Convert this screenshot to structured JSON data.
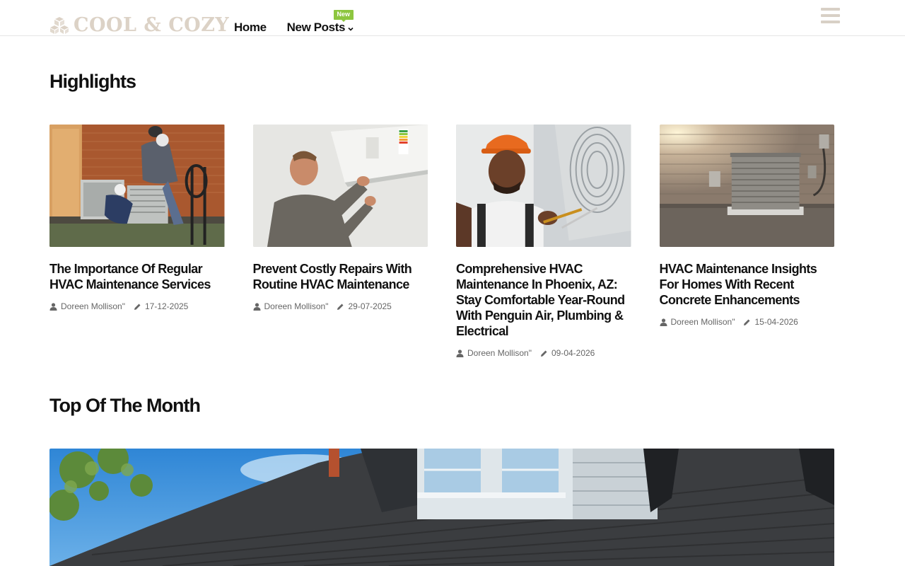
{
  "site": {
    "logo_text": "COOL & COZY",
    "logo_icon": "cubes-icon",
    "accent_color": "#8dc63f",
    "logo_color": "#dcd2c6"
  },
  "nav": {
    "items": [
      {
        "label": "Home"
      },
      {
        "label": "New Posts",
        "badge": "New",
        "has_dropdown": true
      }
    ],
    "menu_icon": "hamburger-icon"
  },
  "sections": {
    "highlights_title": "Highlights",
    "top_title": "Top Of The Month"
  },
  "posts": [
    {
      "title": "The Importance Of Regular HVAC Maintenance Services",
      "author": "Doreen Mollison\"",
      "date": "17-12-2025"
    },
    {
      "title": "Prevent Costly Repairs With Routine HVAC Maintenance",
      "author": "Doreen Mollison\"",
      "date": "29-07-2025"
    },
    {
      "title": "Comprehensive HVAC Maintenance In Phoenix, AZ: Stay Comfortable Year-Round With Penguin Air, Plumbing & Electrical",
      "author": "Doreen Mollison\"",
      "date": "09-04-2026"
    },
    {
      "title": "HVAC Maintenance Insights For Homes With Recent Concrete Enhancements",
      "author": "Doreen Mollison\"",
      "date": "15-04-2026"
    }
  ]
}
